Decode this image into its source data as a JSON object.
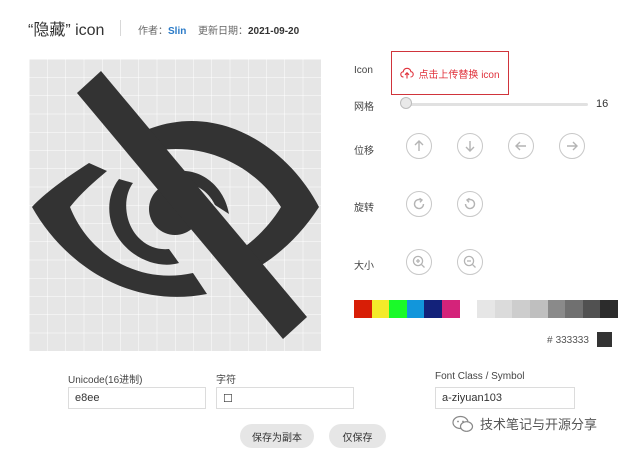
{
  "header": {
    "title": "“隐藏” icon",
    "author_label": "作者：",
    "author": "Slin",
    "date_label": "更新日期：",
    "date": "2021-09-20"
  },
  "controls": {
    "icon_label": "Icon",
    "upload_label": "点击上传替换 icon",
    "grid_label": "网格",
    "grid_value": "16",
    "grid_level": 0.0,
    "move_label": "位移",
    "rotate_label": "旋转",
    "size_label": "大小"
  },
  "palette": [
    "#d81e06",
    "#f4ea2a",
    "#1afa29",
    "#1296db",
    "#13227a",
    "#d4237a",
    "#ffffff",
    "#e6e6e6",
    "#dbdbdb",
    "#cdcdcd",
    "#bfbfbf",
    "#8a8a8a",
    "#707070",
    "#515151",
    "#2c2c2c"
  ],
  "color": {
    "hash": "#",
    "value": "333333",
    "current": "#333333"
  },
  "fields": {
    "unicode_label": "Unicode(16进制)",
    "unicode_value": "e8ee",
    "char_label": "字符",
    "char_value": "☐",
    "fontclass_label": "Font Class / Symbol",
    "fontclass_value": "a-ziyuan103"
  },
  "buttons": {
    "save_copy": "保存为副本",
    "save_only": "仅保存"
  },
  "watermark": {
    "text": "技术笔记与开源分享"
  }
}
